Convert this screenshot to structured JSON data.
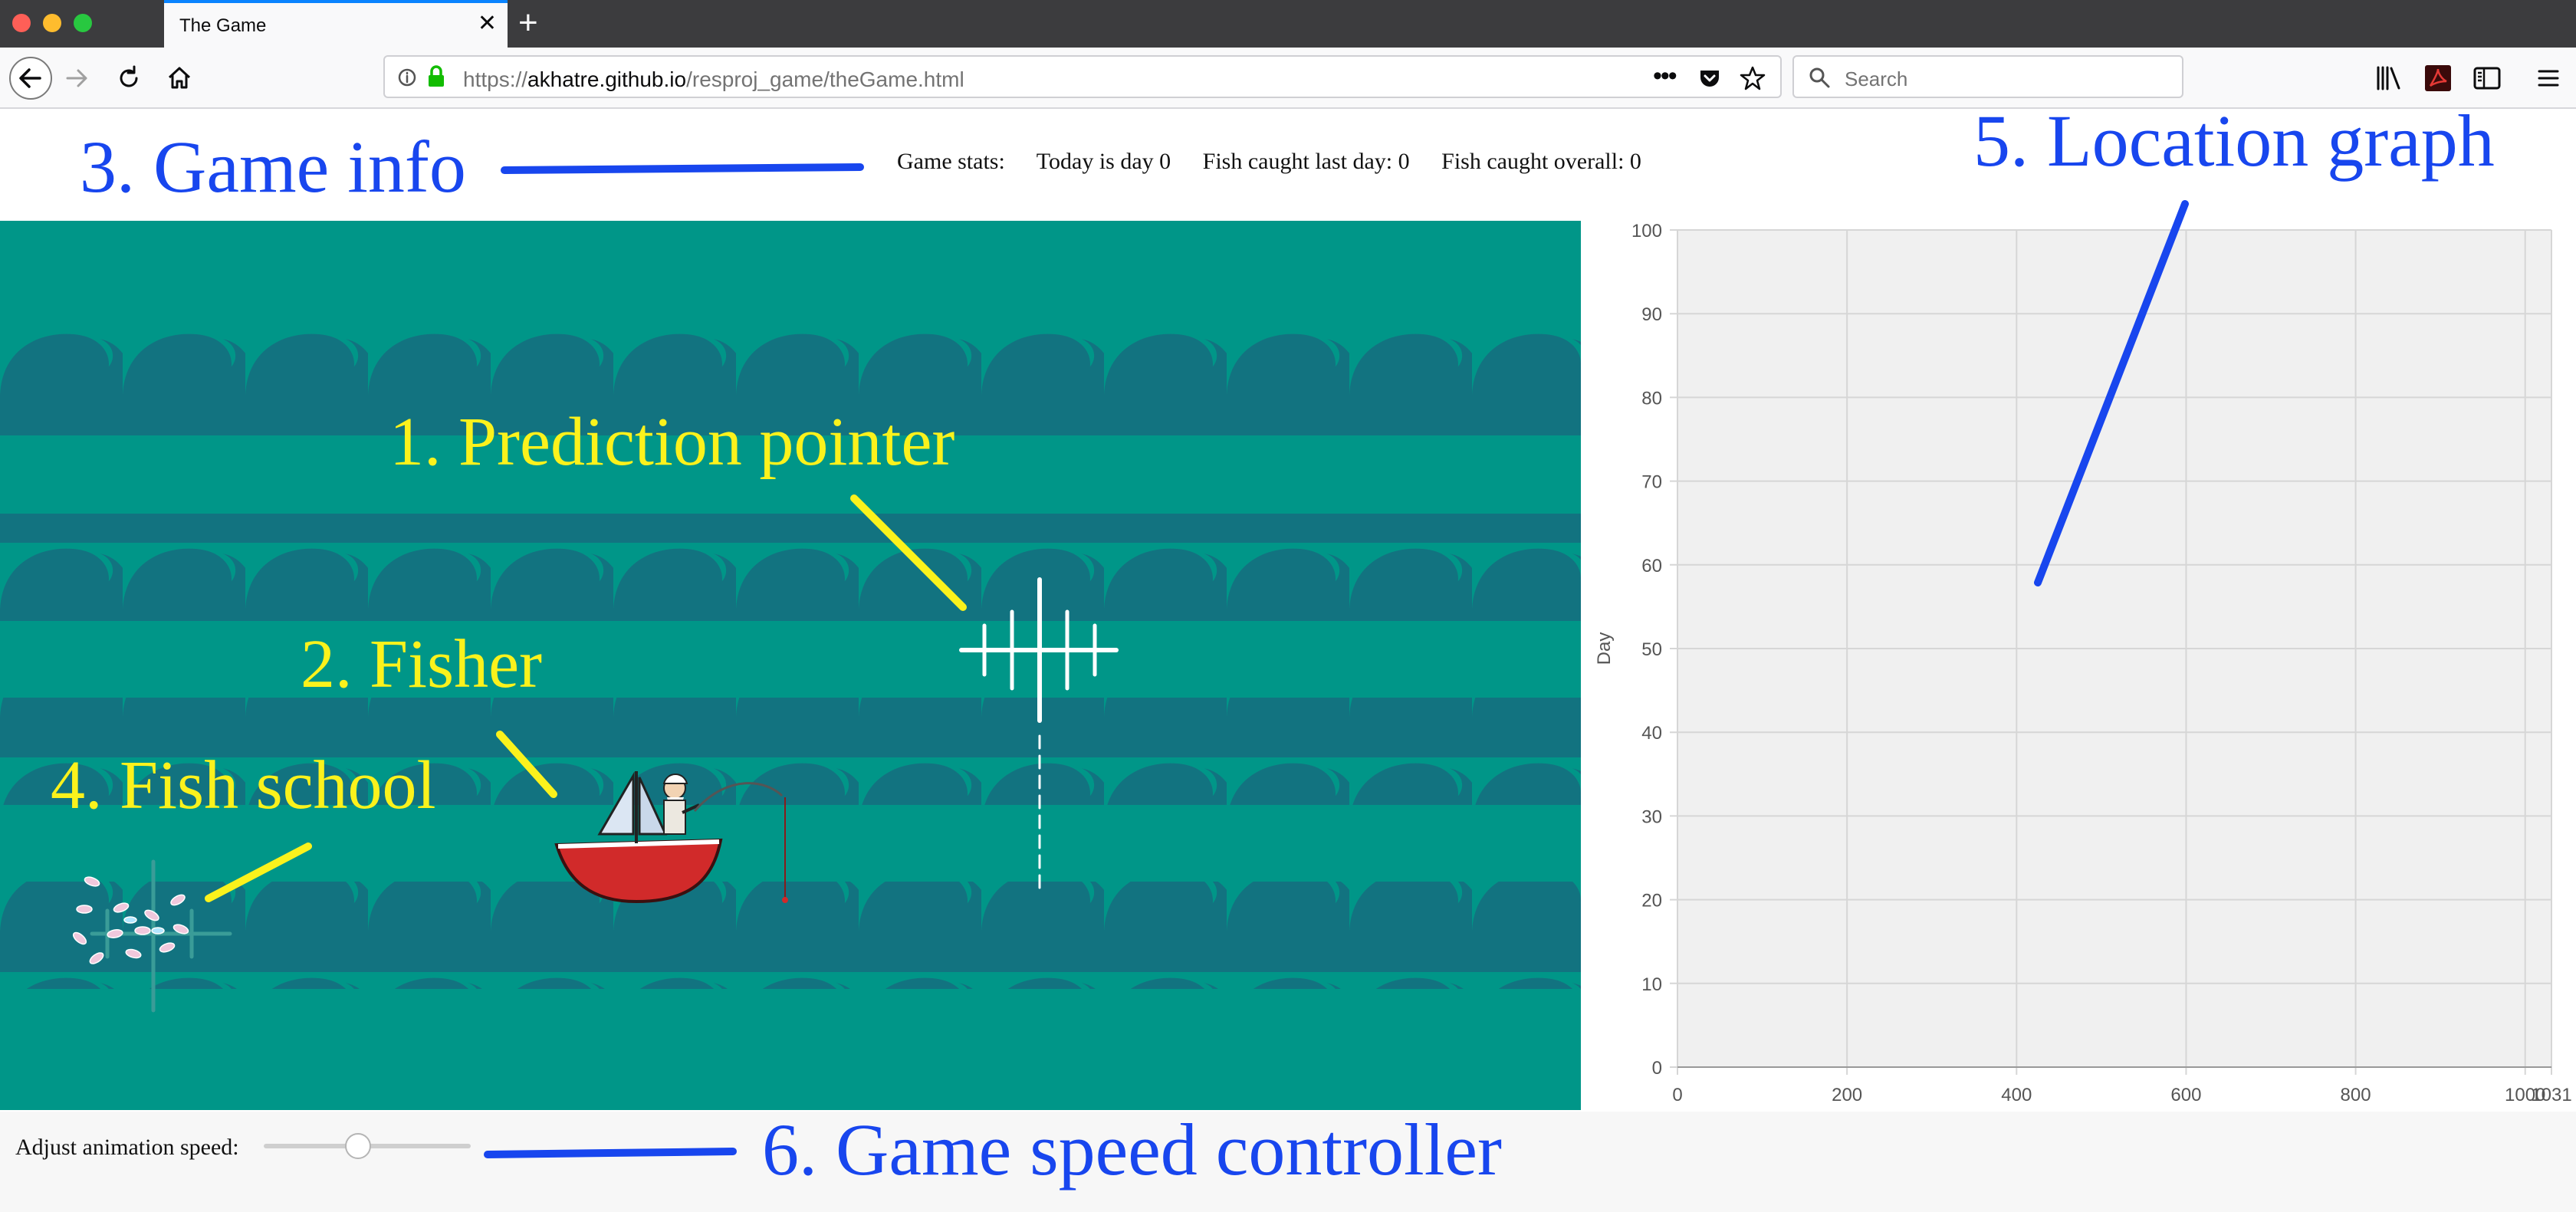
{
  "browser": {
    "tab_title": "The Game",
    "url_prefix": "https://",
    "url_domain": "akhatre.github.io",
    "url_path": "/resproj_game/theGame.html",
    "search_placeholder": "Search"
  },
  "stats": {
    "label": "Game stats:",
    "day": "Today is day 0",
    "last_day": "Fish caught last day: 0",
    "overall": "Fish caught overall: 0"
  },
  "speed": {
    "label": "Adjust animation speed:",
    "value": 0.45
  },
  "annotations": {
    "prediction_pointer": "1. Prediction pointer",
    "fisher": "2. Fisher",
    "game_info": "3. Game info",
    "fish_school": "4. Fish school",
    "location_graph": "5. Location graph",
    "speed_controller": "6. Game speed controller"
  },
  "colors": {
    "sea": "#009688",
    "waves": "#127380",
    "annotation_blue": "#1846ee",
    "annotation_yellow": "#fbf21c",
    "boat": "#d12a2a"
  },
  "chart_data": {
    "type": "line",
    "title": "",
    "xlabel": "",
    "ylabel": "Day",
    "xlim": [
      0,
      1031
    ],
    "ylim": [
      0,
      100
    ],
    "x_ticks": [
      "0",
      "200",
      "400",
      "600",
      "800",
      "1000",
      "1031"
    ],
    "y_ticks": [
      "0",
      "10",
      "20",
      "30",
      "40",
      "50",
      "60",
      "70",
      "80",
      "90",
      "100"
    ],
    "x_tick_values": [
      0,
      200,
      400,
      600,
      800,
      1000,
      1031
    ],
    "y_tick_values": [
      0,
      10,
      20,
      30,
      40,
      50,
      60,
      70,
      80,
      90,
      100
    ],
    "grid": true,
    "series": []
  }
}
